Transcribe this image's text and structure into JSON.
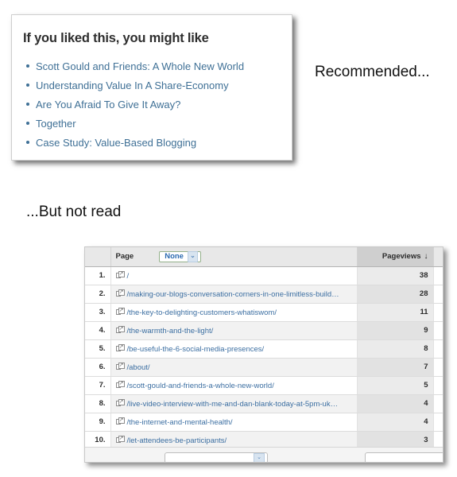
{
  "related_panel": {
    "title": "If you liked this, you might like",
    "links": [
      "Scott Gould and Friends: A Whole New World",
      "Understanding Value In A Share-Economy",
      "Are You Afraid To Give It Away?",
      "Together",
      "Case Study: Value-Based Blogging"
    ]
  },
  "callouts": {
    "recommended": "Recommended...",
    "not_read": "...But not read"
  },
  "analytics": {
    "columns": {
      "page": "Page",
      "pageviews": "Pageviews",
      "sort_arrow": "↓"
    },
    "segment_select": {
      "value": "None",
      "chevrons": "⌄"
    },
    "rows": [
      {
        "rank": "1.",
        "page": "/",
        "pageviews": "38"
      },
      {
        "rank": "2.",
        "page": "/making-our-blogs-conversation-corners-in-one-limitless-build…",
        "pageviews": "28"
      },
      {
        "rank": "3.",
        "page": "/the-key-to-delighting-customers-whatiswom/",
        "pageviews": "11"
      },
      {
        "rank": "4.",
        "page": "/the-warmth-and-the-light/",
        "pageviews": "9"
      },
      {
        "rank": "5.",
        "page": "/be-useful-the-6-social-media-presences/",
        "pageviews": "8"
      },
      {
        "rank": "6.",
        "page": "/about/",
        "pageviews": "7"
      },
      {
        "rank": "7.",
        "page": "/scott-gould-and-friends-a-whole-new-world/",
        "pageviews": "5"
      },
      {
        "rank": "8.",
        "page": "/live-video-interview-with-me-and-dan-blank-today-at-5pm-uk…",
        "pageviews": "4"
      },
      {
        "rank": "9.",
        "page": "/the-internet-and-mental-health/",
        "pageviews": "4"
      },
      {
        "rank": "10.",
        "page": "/let-attendees-be-participants/",
        "pageviews": "3"
      }
    ]
  },
  "colors": {
    "link_blue": "#3f7096",
    "table_link_blue": "#3c6fa2",
    "select_border_green": "#93b08a",
    "select_text_blue": "#2b6ab0",
    "header_grey": "#e8e8e8",
    "pageviews_header_grey": "#cfcfcf"
  }
}
